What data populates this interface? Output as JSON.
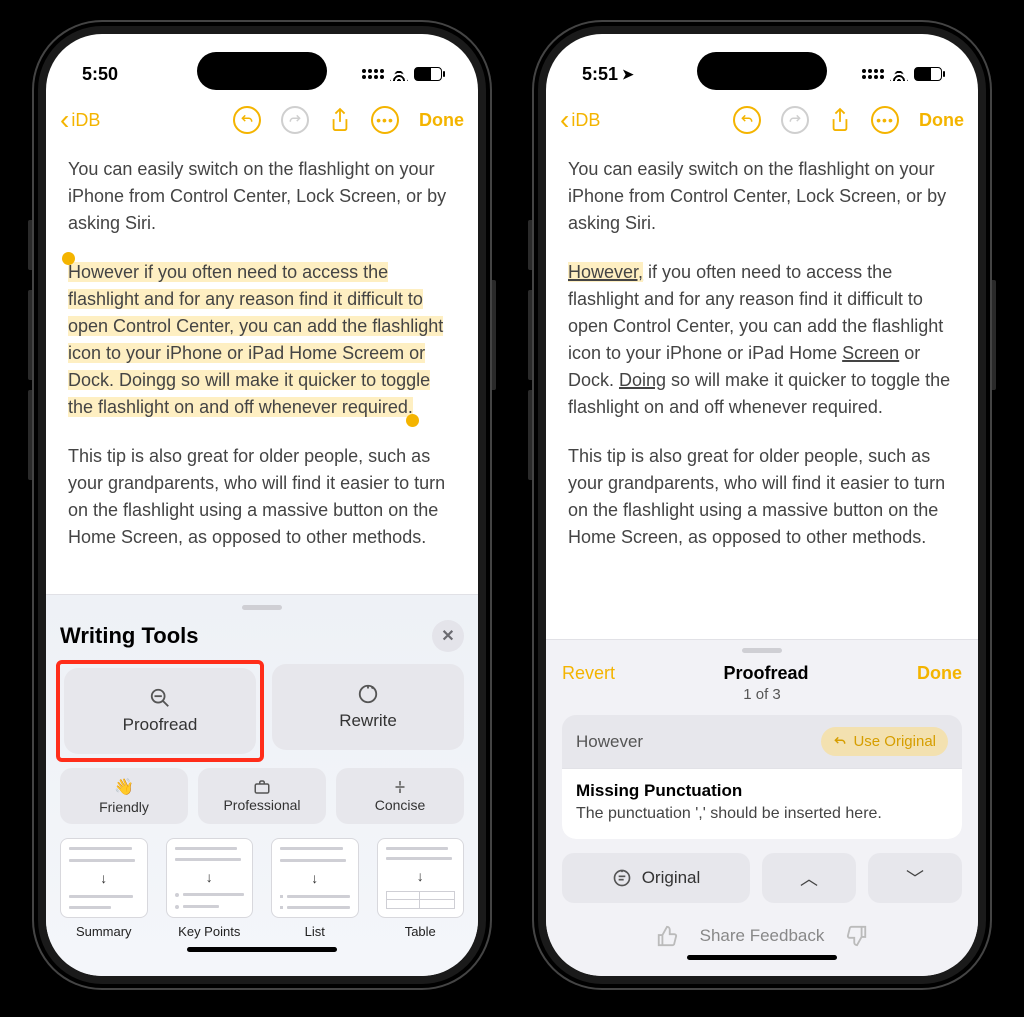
{
  "status": {
    "time_left": "5:50",
    "time_right": "5:51",
    "show_location_arrow_right": true
  },
  "nav": {
    "back_label": "iDB",
    "done_label": "Done"
  },
  "note": {
    "para1": "You can easily switch on the flashlight on your iPhone from Control Center, Lock Screen, or by asking Siri.",
    "para2_original": "However if you often need to access the flashlight and for any reason find it difficult to open Control Center, you can add the flashlight icon to your iPhone or iPad Home Screem or Dock. Doingg so will make it quicker to toggle the flashlight on and off whenever required.",
    "para2_fixed": {
      "w1": "However,",
      "t1": " if you often need to access the flashlight and for any reason find it difficult to open Control Center, you can add the flashlight icon to your iPhone or iPad Home ",
      "w2": "Screen",
      "t2": " or Dock. ",
      "w3": "Doing",
      "t3": " so will make it quicker to toggle the flashlight on and off whenever required."
    },
    "para3": "This tip is also great for older people, such as your grandparents, who will find it easier to turn on the flashlight using a massive button on the Home Screen, as opposed to other methods."
  },
  "writing_tools": {
    "title": "Writing Tools",
    "proofread": "Proofread",
    "rewrite": "Rewrite",
    "friendly": "Friendly",
    "professional": "Professional",
    "concise": "Concise",
    "summary": "Summary",
    "keypoints": "Key Points",
    "list": "List",
    "table": "Table"
  },
  "proofread": {
    "revert": "Revert",
    "title": "Proofread",
    "done": "Done",
    "counter": "1 of 3",
    "word": "However",
    "use_original": "Use Original",
    "issue_title": "Missing Punctuation",
    "issue_body": "The punctuation ',' should be inserted here.",
    "original_btn": "Original",
    "feedback": "Share Feedback"
  }
}
